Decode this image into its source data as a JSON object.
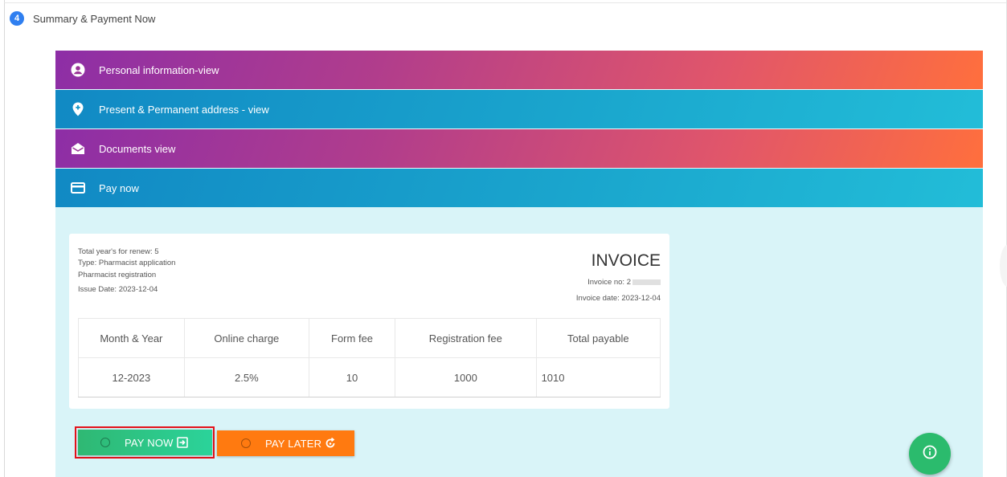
{
  "step": {
    "number": "4",
    "title": "Summary & Payment Now"
  },
  "sections": [
    {
      "label": "Personal information-view",
      "icon": "user-circle-icon"
    },
    {
      "label": "Present & Permanent address - view",
      "icon": "map-pin-icon"
    },
    {
      "label": "Documents view",
      "icon": "envelope-open-icon"
    },
    {
      "label": "Pay now",
      "icon": "credit-card-icon"
    }
  ],
  "invoice": {
    "title": "INVOICE",
    "total_years": "Total year's for renew: 5",
    "type": "Type: Pharmacist application",
    "registration": "Pharmacist registration",
    "issue_date": "Issue Date: 2023-12-04",
    "invoice_no_label": "Invoice no: 2",
    "invoice_date": "Invoice date: 2023-12-04",
    "columns": [
      "Month & Year",
      "Online charge",
      "Form fee",
      "Registration fee",
      "Total payable"
    ],
    "row": [
      "12-2023",
      "2.5%",
      "10",
      "1000",
      "1010"
    ]
  },
  "buttons": {
    "pay_now": "PAY NOW",
    "pay_later": "PAY LATER"
  },
  "colors": {
    "purple_bar_start": "#8d2ea6",
    "purple_bar_end": "#ff6f3d",
    "teal_bar_start": "#1189c4",
    "teal_bar_end": "#22bdd8",
    "pay_now": "#2fb873",
    "pay_later": "#ff7a10",
    "highlight": "#e4111a",
    "fab": "#2bbb6d",
    "step_badge": "#2f7ff0"
  },
  "fab_icon": "info-icon"
}
